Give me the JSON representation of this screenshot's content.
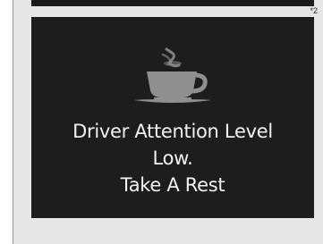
{
  "footnote": "*2",
  "icon": "coffee-cup-icon",
  "message": {
    "line1": "Driver Attention Level",
    "line2": "Low.",
    "line3": "Take A Rest"
  },
  "colors": {
    "screen": "#1d1d1d",
    "icon": "#8f8f8f",
    "text": "#f2f2f2"
  }
}
